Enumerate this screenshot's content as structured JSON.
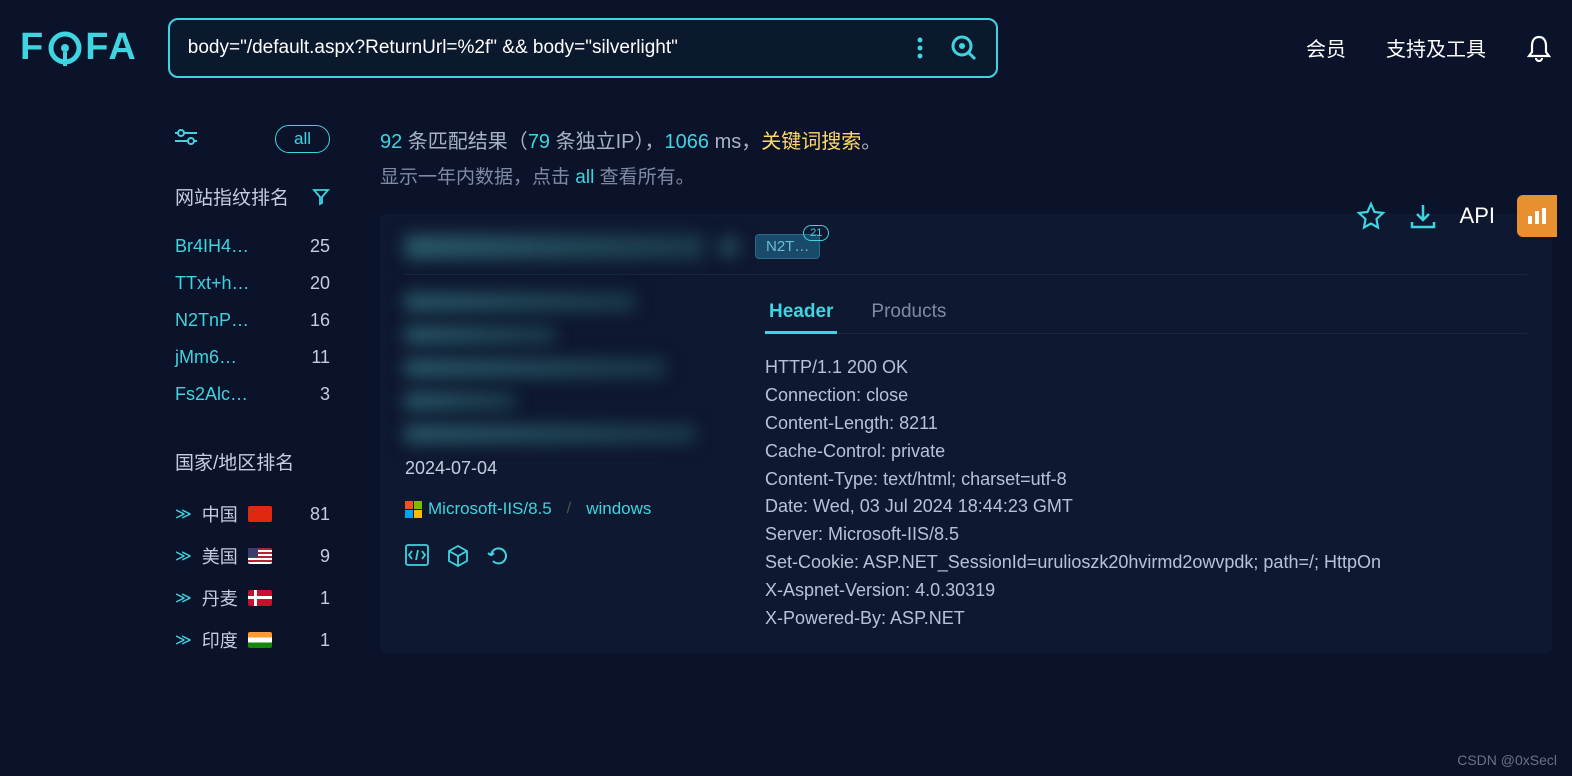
{
  "header": {
    "logo": "FOFA",
    "search_value": "body=\"/default.aspx?ReturnUrl=%2f\" && body=\"silverlight\"",
    "nav": {
      "member": "会员",
      "tools": "支持及工具"
    }
  },
  "sidebar": {
    "all_label": "all",
    "fingerprint_title": "网站指纹排名",
    "fingerprints": [
      {
        "name": "Br4IH4…",
        "count": "25"
      },
      {
        "name": "TTxt+h…",
        "count": "20"
      },
      {
        "name": "N2TnP…",
        "count": "16"
      },
      {
        "name": "jMm6…",
        "count": "11"
      },
      {
        "name": "Fs2Alc…",
        "count": "3"
      }
    ],
    "country_title": "国家/地区排名",
    "countries": [
      {
        "name": "中国",
        "flag": "cn",
        "count": "81"
      },
      {
        "name": "美国",
        "flag": "us",
        "count": "9"
      },
      {
        "name": "丹麦",
        "flag": "dk",
        "count": "1"
      },
      {
        "name": "印度",
        "flag": "in",
        "count": "1"
      }
    ]
  },
  "results": {
    "count": "92",
    "text1": " 条匹配结果（",
    "ip_count": "79",
    "text2": " 条独立IP），",
    "time_ms": "1066",
    "text3": " ms，",
    "keyword": "关键词搜索",
    "period": "。",
    "line2_pre": "显示一年内数据，点击 ",
    "line2_all": "all",
    "line2_post": " 查看所有。",
    "api_label": "API"
  },
  "card": {
    "tag": "N2T…",
    "tag_count": "21",
    "date": "2024-07-04",
    "tech1": "Microsoft-IIS/8.5",
    "tech2": "windows",
    "tabs": {
      "header": "Header",
      "products": "Products"
    },
    "headers": "HTTP/1.1 200 OK\nConnection: close\nContent-Length: 8211\nCache-Control: private\nContent-Type: text/html; charset=utf-8\nDate: Wed, 03 Jul 2024 18:44:23 GMT\nServer: Microsoft-IIS/8.5\nSet-Cookie: ASP.NET_SessionId=urulioszk20hvirmd2owvpdk; path=/; HttpOn\nX-Aspnet-Version: 4.0.30319\nX-Powered-By: ASP.NET"
  },
  "watermark": "CSDN @0xSecl"
}
